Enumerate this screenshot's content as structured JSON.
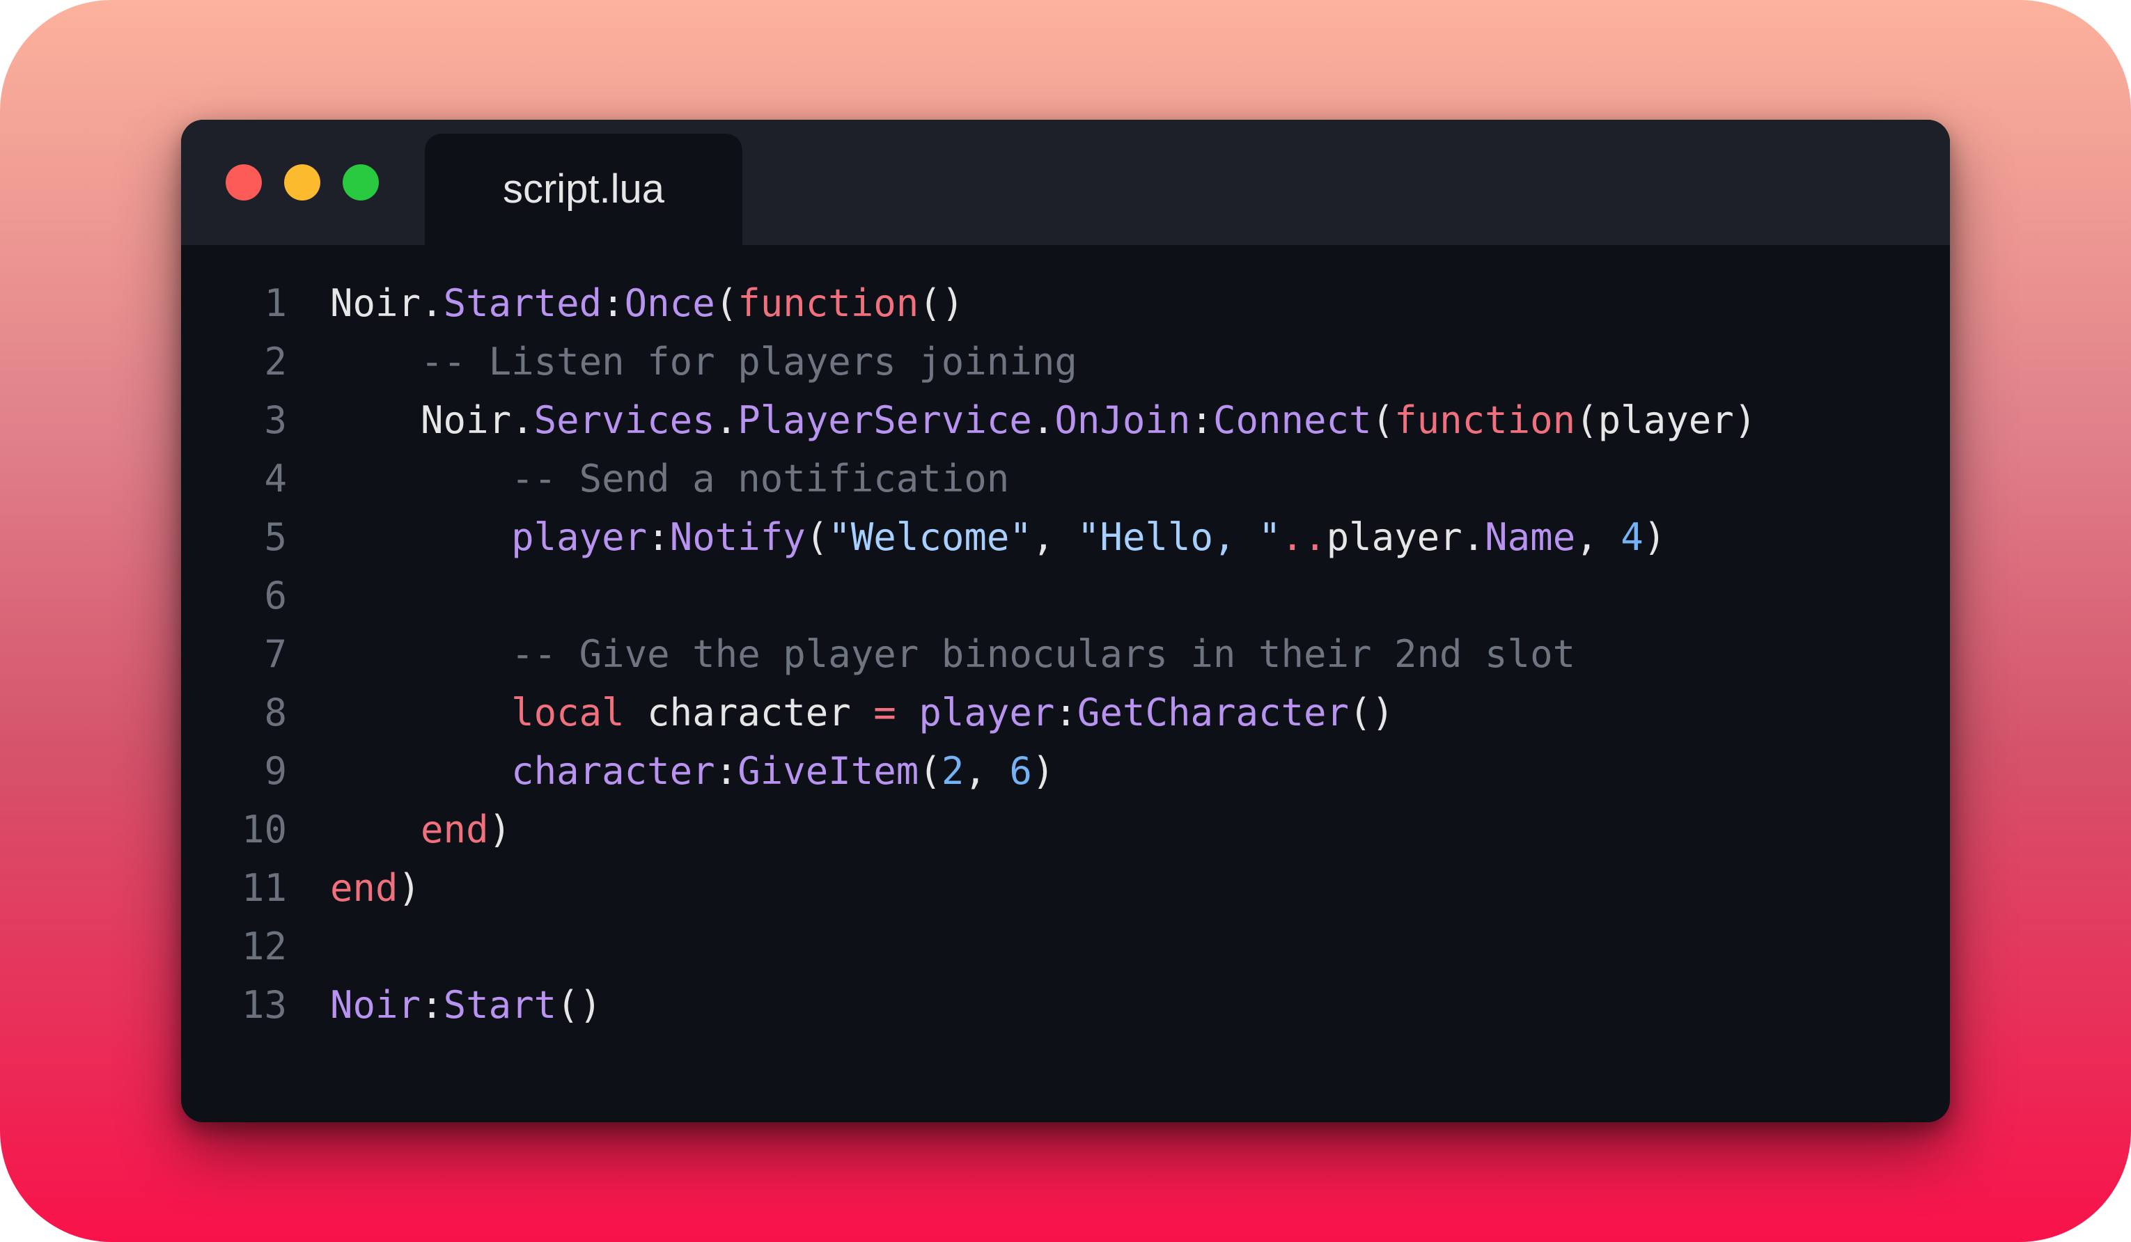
{
  "window": {
    "tab_title": "script.lua",
    "traffic_lights": [
      {
        "name": "close",
        "color": "#fc5b57"
      },
      {
        "name": "minimize",
        "color": "#fcbb2e"
      },
      {
        "name": "zoom",
        "color": "#29c940"
      }
    ]
  },
  "colors": {
    "plain": "#e6e6e6",
    "member": "#b993f0",
    "keyword": "#f0717d",
    "comment": "#6e7480",
    "string": "#a8d0ff",
    "number": "#74b3f5",
    "line_number": "#6b717d",
    "editor_bg": "#0d1017",
    "titlebar_bg": "#1d2029"
  },
  "code": {
    "lines": [
      {
        "number": "1",
        "tokens": [
          {
            "text": "Noir",
            "type": "plain"
          },
          {
            "text": ".",
            "type": "plain"
          },
          {
            "text": "Started",
            "type": "member"
          },
          {
            "text": ":",
            "type": "plain"
          },
          {
            "text": "Once",
            "type": "member"
          },
          {
            "text": "(",
            "type": "plain"
          },
          {
            "text": "function",
            "type": "keyword"
          },
          {
            "text": "()",
            "type": "plain"
          }
        ]
      },
      {
        "number": "2",
        "tokens": [
          {
            "text": "    -- Listen for players joining",
            "type": "comment"
          }
        ]
      },
      {
        "number": "3",
        "tokens": [
          {
            "text": "    Noir",
            "type": "plain"
          },
          {
            "text": ".",
            "type": "plain"
          },
          {
            "text": "Services",
            "type": "member"
          },
          {
            "text": ".",
            "type": "plain"
          },
          {
            "text": "PlayerService",
            "type": "member"
          },
          {
            "text": ".",
            "type": "plain"
          },
          {
            "text": "OnJoin",
            "type": "member"
          },
          {
            "text": ":",
            "type": "plain"
          },
          {
            "text": "Connect",
            "type": "member"
          },
          {
            "text": "(",
            "type": "plain"
          },
          {
            "text": "function",
            "type": "keyword"
          },
          {
            "text": "(player)",
            "type": "plain"
          }
        ]
      },
      {
        "number": "4",
        "tokens": [
          {
            "text": "        -- Send a notification",
            "type": "comment"
          }
        ]
      },
      {
        "number": "5",
        "tokens": [
          {
            "text": "        ",
            "type": "plain"
          },
          {
            "text": "player",
            "type": "member"
          },
          {
            "text": ":",
            "type": "plain"
          },
          {
            "text": "Notify",
            "type": "member"
          },
          {
            "text": "(",
            "type": "plain"
          },
          {
            "text": "\"Welcome\"",
            "type": "string"
          },
          {
            "text": ", ",
            "type": "plain"
          },
          {
            "text": "\"Hello, \"",
            "type": "string"
          },
          {
            "text": "..",
            "type": "keyword"
          },
          {
            "text": "player",
            "type": "plain"
          },
          {
            "text": ".",
            "type": "plain"
          },
          {
            "text": "Name",
            "type": "member"
          },
          {
            "text": ", ",
            "type": "plain"
          },
          {
            "text": "4",
            "type": "number"
          },
          {
            "text": ")",
            "type": "plain"
          }
        ]
      },
      {
        "number": "6",
        "tokens": []
      },
      {
        "number": "7",
        "tokens": [
          {
            "text": "        -- Give the player binoculars in their 2nd slot",
            "type": "comment"
          }
        ]
      },
      {
        "number": "8",
        "tokens": [
          {
            "text": "        ",
            "type": "plain"
          },
          {
            "text": "local",
            "type": "keyword"
          },
          {
            "text": " character ",
            "type": "plain"
          },
          {
            "text": "=",
            "type": "keyword"
          },
          {
            "text": " ",
            "type": "plain"
          },
          {
            "text": "player",
            "type": "member"
          },
          {
            "text": ":",
            "type": "plain"
          },
          {
            "text": "GetCharacter",
            "type": "member"
          },
          {
            "text": "()",
            "type": "plain"
          }
        ]
      },
      {
        "number": "9",
        "tokens": [
          {
            "text": "        ",
            "type": "plain"
          },
          {
            "text": "character",
            "type": "member"
          },
          {
            "text": ":",
            "type": "plain"
          },
          {
            "text": "GiveItem",
            "type": "member"
          },
          {
            "text": "(",
            "type": "plain"
          },
          {
            "text": "2",
            "type": "number"
          },
          {
            "text": ", ",
            "type": "plain"
          },
          {
            "text": "6",
            "type": "number"
          },
          {
            "text": ")",
            "type": "plain"
          }
        ]
      },
      {
        "number": "10",
        "tokens": [
          {
            "text": "    ",
            "type": "plain"
          },
          {
            "text": "end",
            "type": "keyword"
          },
          {
            "text": ")",
            "type": "plain"
          }
        ]
      },
      {
        "number": "11",
        "tokens": [
          {
            "text": "end",
            "type": "keyword"
          },
          {
            "text": ")",
            "type": "plain"
          }
        ]
      },
      {
        "number": "12",
        "tokens": []
      },
      {
        "number": "13",
        "tokens": [
          {
            "text": "Noir",
            "type": "member"
          },
          {
            "text": ":",
            "type": "plain"
          },
          {
            "text": "Start",
            "type": "member"
          },
          {
            "text": "()",
            "type": "plain"
          }
        ]
      }
    ]
  }
}
